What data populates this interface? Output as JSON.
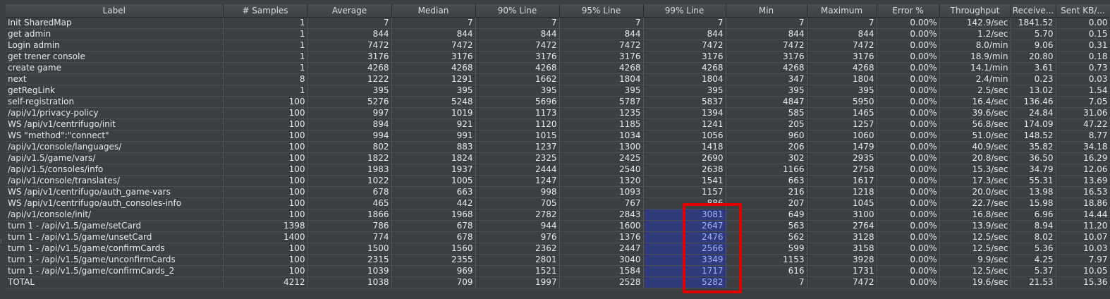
{
  "columns": [
    "Label",
    "# Samples",
    "Average",
    "Median",
    "90% Line",
    "95% Line",
    "99% Line",
    "Min",
    "Maximum",
    "Error %",
    "Throughput",
    "Receive...",
    "Sent KB/..."
  ],
  "rows": [
    [
      "Init SharedMap",
      "1",
      "7",
      "7",
      "7",
      "7",
      "7",
      "7",
      "7",
      "0.00%",
      "142.9/sec",
      "1841.52",
      "0.00"
    ],
    [
      "get admin",
      "1",
      "844",
      "844",
      "844",
      "844",
      "844",
      "844",
      "844",
      "0.00%",
      "1.2/sec",
      "5.70",
      "0.15"
    ],
    [
      "Login admin",
      "1",
      "7472",
      "7472",
      "7472",
      "7472",
      "7472",
      "7472",
      "7472",
      "0.00%",
      "8.0/min",
      "9.06",
      "0.31"
    ],
    [
      "get trener console",
      "1",
      "3176",
      "3176",
      "3176",
      "3176",
      "3176",
      "3176",
      "3176",
      "0.00%",
      "18.9/min",
      "20.80",
      "0.18"
    ],
    [
      "create game",
      "1",
      "4268",
      "4268",
      "4268",
      "4268",
      "4268",
      "4268",
      "4268",
      "0.00%",
      "14.1/min",
      "3.61",
      "0.73"
    ],
    [
      "next",
      "8",
      "1222",
      "1291",
      "1662",
      "1804",
      "1804",
      "347",
      "1804",
      "0.00%",
      "2.4/min",
      "0.23",
      "0.03"
    ],
    [
      "getRegLink",
      "1",
      "395",
      "395",
      "395",
      "395",
      "395",
      "395",
      "395",
      "0.00%",
      "2.5/sec",
      "13.02",
      "1.54"
    ],
    [
      "self-registration",
      "100",
      "5276",
      "5248",
      "5696",
      "5787",
      "5837",
      "4847",
      "5950",
      "0.00%",
      "16.4/sec",
      "136.46",
      "7.05"
    ],
    [
      "/api/v1/privacy-policy",
      "100",
      "997",
      "1019",
      "1173",
      "1235",
      "1394",
      "585",
      "1465",
      "0.00%",
      "39.6/sec",
      "24.84",
      "31.06"
    ],
    [
      "WS /api/v1/centrifugo/init",
      "100",
      "894",
      "921",
      "1120",
      "1185",
      "1241",
      "205",
      "1257",
      "0.00%",
      "56.8/sec",
      "174.09",
      "47.22"
    ],
    [
      "WS \"method\":\"connect\"",
      "100",
      "994",
      "991",
      "1015",
      "1034",
      "1056",
      "960",
      "1060",
      "0.00%",
      "51.0/sec",
      "148.52",
      "8.77"
    ],
    [
      "/api/v1/console/languages/",
      "100",
      "802",
      "883",
      "1237",
      "1300",
      "1418",
      "206",
      "1479",
      "0.00%",
      "40.9/sec",
      "35.82",
      "34.18"
    ],
    [
      "/api/v1.5/game/vars/",
      "100",
      "1822",
      "1824",
      "2325",
      "2425",
      "2690",
      "302",
      "2935",
      "0.00%",
      "20.8/sec",
      "36.50",
      "16.29"
    ],
    [
      "/api/v1.5/consoles/info",
      "100",
      "1983",
      "1937",
      "2444",
      "2540",
      "2638",
      "1166",
      "2758",
      "0.00%",
      "15.3/sec",
      "34.79",
      "12.06"
    ],
    [
      "/api/v1/console/translates/",
      "100",
      "1022",
      "1005",
      "1247",
      "1320",
      "1541",
      "663",
      "1617",
      "0.00%",
      "17.3/sec",
      "55.31",
      "13.69"
    ],
    [
      "WS /api/v1/centrifugo/auth_game-vars",
      "100",
      "678",
      "663",
      "998",
      "1093",
      "1157",
      "216",
      "1218",
      "0.00%",
      "20.0/sec",
      "13.98",
      "16.53"
    ],
    [
      "WS /api/v1/centrifugo/auth_consoles-info",
      "100",
      "465",
      "442",
      "705",
      "767",
      "886",
      "207",
      "1045",
      "0.00%",
      "22.7/sec",
      "15.98",
      "18.86"
    ],
    [
      "/api/v1/console/init/",
      "100",
      "1866",
      "1968",
      "2782",
      "2843",
      "3081",
      "649",
      "3100",
      "0.00%",
      "16.8/sec",
      "6.96",
      "14.44"
    ],
    [
      "turn 1 - /api/v1.5/game/setCard",
      "1398",
      "786",
      "678",
      "944",
      "1600",
      "2647",
      "563",
      "2764",
      "0.00%",
      "13.9/sec",
      "8.94",
      "11.20"
    ],
    [
      "turn 1 - /api/v1.5/game/unsetCard",
      "1400",
      "774",
      "678",
      "976",
      "1376",
      "2476",
      "562",
      "3128",
      "0.00%",
      "12.5/sec",
      "8.02",
      "10.07"
    ],
    [
      "turn 1 - /api/v1.5/game/confirmCards",
      "100",
      "1500",
      "1560",
      "2362",
      "2447",
      "2566",
      "599",
      "3158",
      "0.00%",
      "12.5/sec",
      "5.36",
      "10.03"
    ],
    [
      "turn 1 - /api/v1.5/game/unconfirmCards",
      "100",
      "2315",
      "2355",
      "2801",
      "3040",
      "3349",
      "1153",
      "3928",
      "0.00%",
      "9.9/sec",
      "4.25",
      "7.97"
    ],
    [
      "turn 1 - /api/v1.5/game/confirmCards_2",
      "100",
      "1039",
      "969",
      "1521",
      "1584",
      "1717",
      "616",
      "1731",
      "0.00%",
      "12.5/sec",
      "5.37",
      "10.05"
    ],
    [
      "TOTAL",
      "4212",
      "1038",
      "709",
      "1997",
      "2528",
      "5282",
      "7",
      "7472",
      "0.00%",
      "19.6/sec",
      "21.53",
      "15.36"
    ]
  ],
  "selected_column_index": 6,
  "selected_from_row_index": 17,
  "colors": {
    "selection_bg": "#2f3a7a",
    "highlight_border": "#e00000",
    "background": "#3c3f41"
  }
}
